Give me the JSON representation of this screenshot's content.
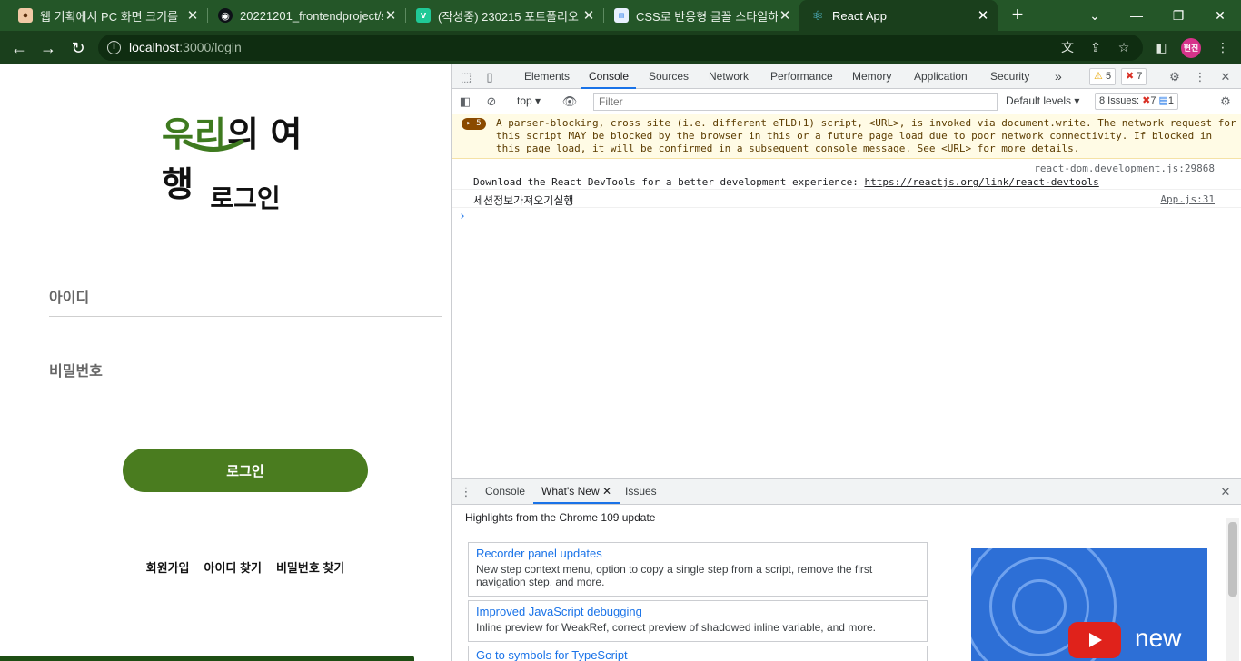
{
  "browser": {
    "tabs": [
      {
        "title": "웹 기획에서 PC 화면 크기를",
        "favicon": "avatar-icon"
      },
      {
        "title": "20221201_frontendproject/s",
        "favicon": "github-icon"
      },
      {
        "title": "(작성중) 230215 포트폴리오",
        "favicon": "velog-icon"
      },
      {
        "title": "CSS로 반응형 글꼴 스타일하",
        "favicon": "dale-icon"
      },
      {
        "title": "React App",
        "favicon": "react-icon"
      }
    ],
    "url_host": "localhost",
    "url_rest": ":3000/login",
    "profile_initials": "현진",
    "accent_color": "#245628"
  },
  "page": {
    "logo": {
      "part1": "우",
      "part2": "리",
      "part3": "의 여행"
    },
    "title": "로그인",
    "id_placeholder": "아이디",
    "password_placeholder": "비밀번호",
    "login_button": "로그인",
    "links": [
      "회원가입",
      "아이디 찾기",
      "비밀번호 찾기"
    ],
    "brand_color": "#4a7c1f"
  },
  "devtools": {
    "tabs": [
      "Elements",
      "Console",
      "Sources",
      "Network",
      "Performance",
      "Memory",
      "Application",
      "Security"
    ],
    "active_tab": "Console",
    "more": "»",
    "warnings_count": "5",
    "errors_count": "7",
    "context": "top",
    "filter_placeholder": "Filter",
    "levels": "Default levels",
    "issues_label": "8 Issues:",
    "issues_errors": "7",
    "issues_info": "1",
    "console": {
      "warning": {
        "count": "5",
        "text": "A parser-blocking, cross site (i.e. different eTLD+1) script, <URL>, is invoked via document.write. The network request for this script MAY be blocked by the browser in this or a future page load due to poor network connectivity. If blocked in this page load, it will be confirmed in a subsequent console message. See <URL> for more details."
      },
      "logs": [
        {
          "source": "react-dom.development.js:29868",
          "text": "Download the React DevTools for a better development experience: ",
          "link": "https://reactjs.org/link/react-devtools"
        },
        {
          "source": "App.js:31",
          "text": "세션정보가져오기실행",
          "link": ""
        }
      ],
      "prompt": "›"
    },
    "drawer": {
      "tabs": [
        "Console",
        "What's New",
        "Issues"
      ],
      "active_tab": "What's New",
      "heading": "Highlights from the Chrome 109 update",
      "cards": [
        {
          "title": "Recorder panel updates",
          "desc": "New step context menu, option to copy a single step from a script, remove the first navigation step, and more."
        },
        {
          "title": "Improved JavaScript debugging",
          "desc": "Inline preview for WeakRef, correct preview of shadowed inline variable, and more."
        },
        {
          "title": "Go to symbols for TypeScript",
          "desc": ""
        }
      ],
      "promo_text": "new"
    }
  }
}
